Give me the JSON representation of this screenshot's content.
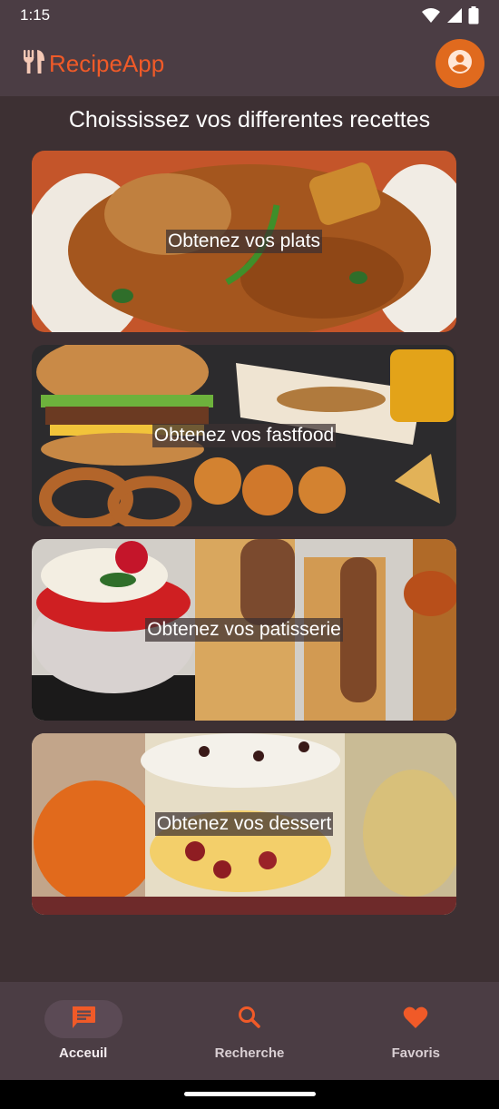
{
  "status_bar": {
    "time": "1:15"
  },
  "app_bar": {
    "title": "RecipeApp"
  },
  "main": {
    "heading": "Choississez vos differentes recettes",
    "cards": [
      {
        "label": "Obtenez vos plats"
      },
      {
        "label": "Obtenez vos fastfood"
      },
      {
        "label": "Obtenez vos patisserie"
      },
      {
        "label": "Obtenez vos dessert"
      }
    ]
  },
  "bottom_nav": {
    "items": [
      {
        "label": "Acceuil",
        "icon": "chat-icon",
        "active": true
      },
      {
        "label": "Recherche",
        "icon": "search-icon",
        "active": false
      },
      {
        "label": "Favoris",
        "icon": "heart-icon",
        "active": false
      }
    ]
  },
  "colors": {
    "accent": "#f05a28",
    "app_bar_bg": "#4b3d44",
    "background": "#3d3033",
    "avatar_bg": "#e06a1e"
  }
}
